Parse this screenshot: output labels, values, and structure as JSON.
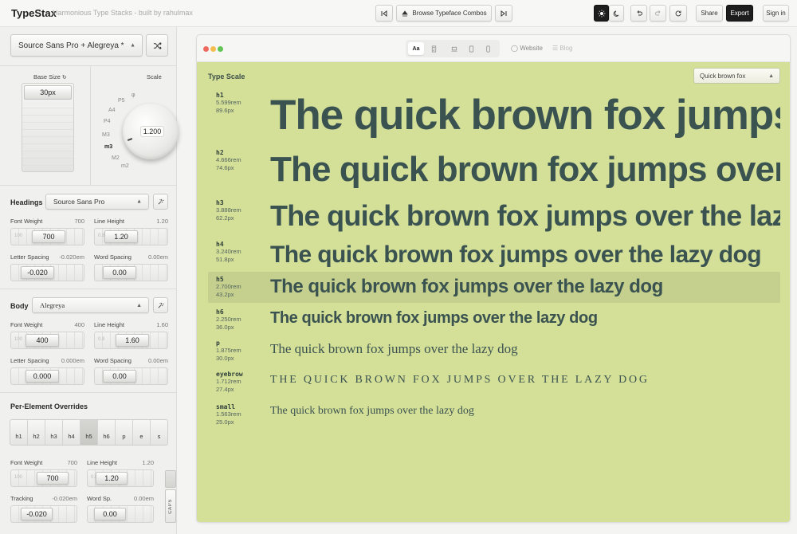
{
  "app": {
    "title": "TypeStax",
    "tagline": "Harmonious Type Stacks - built by rahulmax"
  },
  "toolbar": {
    "browse_label": "Browse Typeface Combos",
    "share_label": "Share",
    "export_label": "Export",
    "signin_label": "Sign in"
  },
  "sidebar": {
    "combo_select": "Source Sans Pro + Alegreya *",
    "base_size": {
      "label": "Base Size",
      "value": "30px"
    },
    "scale": {
      "label": "Scale",
      "value": "1.200",
      "options": [
        "φ",
        "P5",
        "A4",
        "P4",
        "M3",
        "m3",
        "M2",
        "m2"
      ]
    },
    "headings": {
      "title": "Headings",
      "font": "Source Sans Pro",
      "font_weight": {
        "label": "Font Weight",
        "value": "700",
        "min": "100"
      },
      "line_height": {
        "label": "Line Height",
        "value": "1.20",
        "min": "0.8"
      },
      "letter_spacing": {
        "label": "Letter Spacing",
        "value": "-0.020em",
        "display": "-0.020"
      },
      "word_spacing": {
        "label": "Word Spacing",
        "value": "0.00em",
        "display": "0.00"
      }
    },
    "body": {
      "title": "Body",
      "font": "Alegreya",
      "font_weight": {
        "label": "Font Weight",
        "value": "400",
        "min": "100"
      },
      "line_height": {
        "label": "Line Height",
        "value": "1.60",
        "min": "0.8"
      },
      "letter_spacing": {
        "label": "Letter Spacing",
        "value": "0.000em",
        "display": "0.000"
      },
      "word_spacing": {
        "label": "Word Spacing",
        "value": "0.00em",
        "display": "0.00"
      }
    },
    "overrides": {
      "title": "Per-Element Overrides",
      "tabs": [
        "h1",
        "h2",
        "h3",
        "h4",
        "h5",
        "h6",
        "p",
        "e",
        "s"
      ],
      "active_tab": "h5",
      "font_weight": {
        "label": "Font Weight",
        "value": "700",
        "min": "100"
      },
      "line_height": {
        "label": "Line Height",
        "value": "1.20",
        "min": "0.8"
      },
      "tracking": {
        "label": "Tracking",
        "value": "-0.020em",
        "display": "-0.020"
      },
      "word_sp": {
        "label": "Word Sp.",
        "value": "0.00em",
        "display": "0.00"
      },
      "caps_label": "CAPS"
    }
  },
  "preview": {
    "tabs": {
      "aa": "Aa",
      "website": "Website",
      "blog": "Blog"
    },
    "title": "Type Scale",
    "sample_select": "Quick brown fox",
    "rows": [
      {
        "tag": "h1",
        "rem": "5.599rem",
        "px": "89.6px",
        "text": "The quick brown fox jumps over the lazy dog"
      },
      {
        "tag": "h2",
        "rem": "4.666rem",
        "px": "74.6px",
        "text": "The quick brown fox jumps over the lazy dog"
      },
      {
        "tag": "h3",
        "rem": "3.888rem",
        "px": "62.2px",
        "text": "The quick brown fox jumps over the lazy dog"
      },
      {
        "tag": "h4",
        "rem": "3.240rem",
        "px": "51.8px",
        "text": "The quick brown fox jumps over the lazy dog"
      },
      {
        "tag": "h5",
        "rem": "2.700rem",
        "px": "43.2px",
        "text": "The quick brown fox jumps over the lazy dog"
      },
      {
        "tag": "h6",
        "rem": "2.250rem",
        "px": "36.0px",
        "text": "The quick brown fox jumps over the lazy dog"
      },
      {
        "tag": "p",
        "rem": "1.875rem",
        "px": "30.0px",
        "text": "The quick brown fox jumps over the lazy dog"
      },
      {
        "tag": "eyebrow",
        "rem": "1.712rem",
        "px": "27.4px",
        "text": "THE QUICK BROWN FOX JUMPS OVER THE LAZY DOG"
      },
      {
        "tag": "small",
        "rem": "1.563rem",
        "px": "25.0px",
        "text": "The quick brown fox jumps over the lazy dog"
      }
    ]
  },
  "colors": {
    "preview_bg": "#d4df98",
    "heading_text": "#3b5350",
    "accent_dark": "#1d1d1d"
  }
}
